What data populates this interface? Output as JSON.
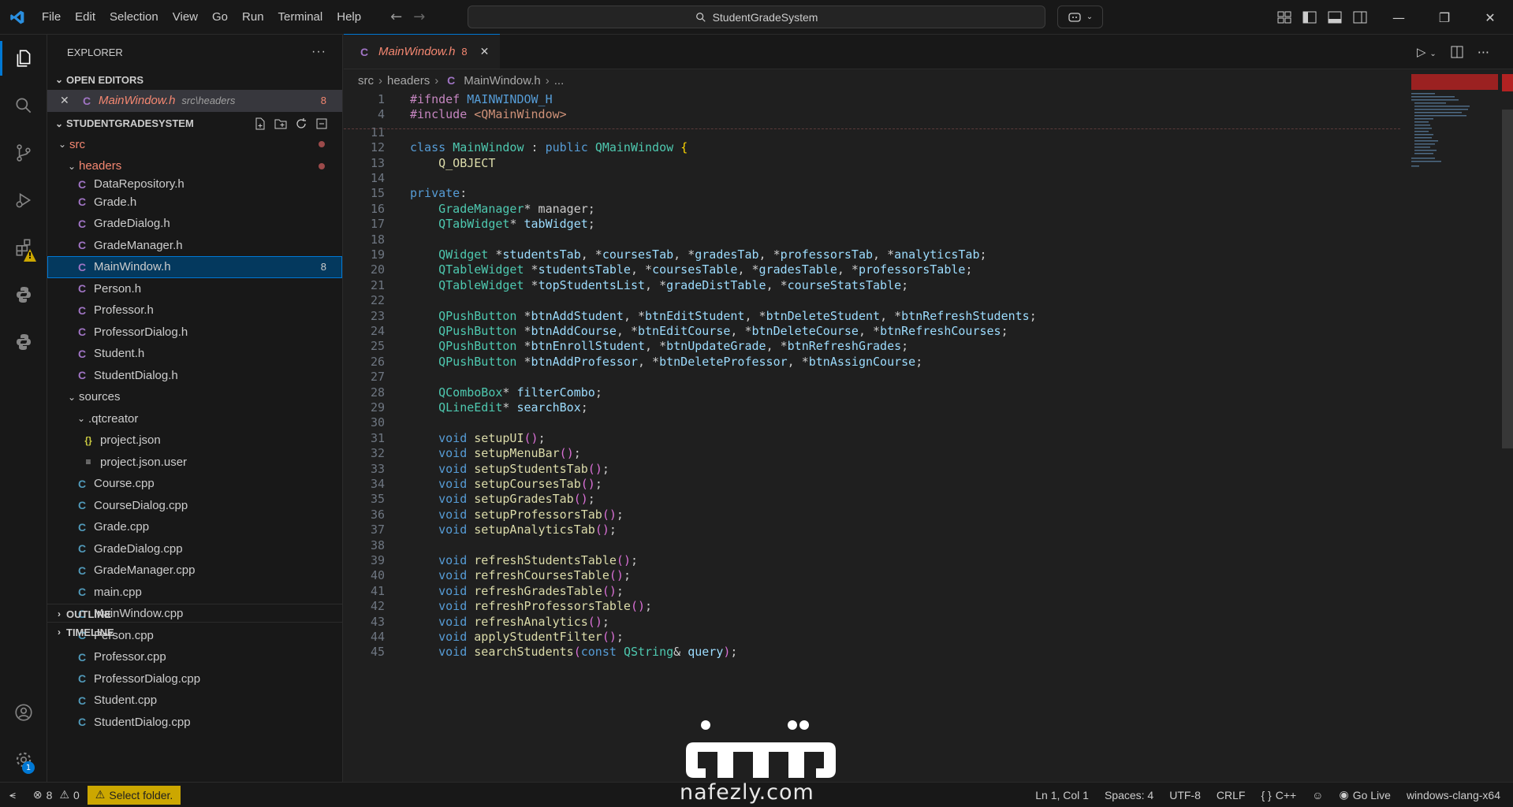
{
  "menu": [
    "File",
    "Edit",
    "Selection",
    "View",
    "Go",
    "Run",
    "Terminal",
    "Help"
  ],
  "search": {
    "text": "StudentGradeSystem"
  },
  "sidebar": {
    "title": "EXPLORER",
    "open_editors_label": "OPEN EDITORS",
    "open_editor": {
      "name": "MainWindow.h",
      "path": "src\\headers",
      "count": "8"
    },
    "project_label": "STUDENTGRADESYSTEM",
    "tree": [
      {
        "name": "src",
        "kind": "folder",
        "indent": 0,
        "dot": true
      },
      {
        "name": "headers",
        "kind": "folder",
        "indent": 1,
        "dot": true
      },
      {
        "name": "DataRepository.h",
        "kind": "h",
        "indent": 2
      },
      {
        "name": "Grade.h",
        "kind": "h",
        "indent": 2
      },
      {
        "name": "GradeDialog.h",
        "kind": "h",
        "indent": 2
      },
      {
        "name": "GradeManager.h",
        "kind": "h",
        "indent": 2
      },
      {
        "name": "MainWindow.h",
        "kind": "h",
        "indent": 2,
        "selected": true,
        "count": "8"
      },
      {
        "name": "Person.h",
        "kind": "h",
        "indent": 2
      },
      {
        "name": "Professor.h",
        "kind": "h",
        "indent": 2
      },
      {
        "name": "ProfessorDialog.h",
        "kind": "h",
        "indent": 2
      },
      {
        "name": "Student.h",
        "kind": "h",
        "indent": 2
      },
      {
        "name": "StudentDialog.h",
        "kind": "h",
        "indent": 2
      },
      {
        "name": "sources",
        "kind": "folder",
        "indent": 1
      },
      {
        "name": ".qtcreator",
        "kind": "folder",
        "indent": 2
      },
      {
        "name": "project.json",
        "kind": "json",
        "indent": 3
      },
      {
        "name": "project.json.user",
        "kind": "txt",
        "indent": 3
      },
      {
        "name": "Course.cpp",
        "kind": "cpp",
        "indent": 2
      },
      {
        "name": "CourseDialog.cpp",
        "kind": "cpp",
        "indent": 2
      },
      {
        "name": "Grade.cpp",
        "kind": "cpp",
        "indent": 2
      },
      {
        "name": "GradeDialog.cpp",
        "kind": "cpp",
        "indent": 2
      },
      {
        "name": "GradeManager.cpp",
        "kind": "cpp",
        "indent": 2
      },
      {
        "name": "main.cpp",
        "kind": "cpp",
        "indent": 2
      },
      {
        "name": "MainWindow.cpp",
        "kind": "cpp",
        "indent": 2
      },
      {
        "name": "Person.cpp",
        "kind": "cpp",
        "indent": 2
      },
      {
        "name": "Professor.cpp",
        "kind": "cpp",
        "indent": 2
      },
      {
        "name": "ProfessorDialog.cpp",
        "kind": "cpp",
        "indent": 2
      },
      {
        "name": "Student.cpp",
        "kind": "cpp",
        "indent": 2
      },
      {
        "name": "StudentDialog.cpp",
        "kind": "cpp",
        "indent": 2
      }
    ],
    "outline_label": "OUTLINE",
    "timeline_label": "TIMELINE"
  },
  "tab": {
    "name": "MainWindow.h",
    "count": "8"
  },
  "breadcrumb": [
    "src",
    "headers",
    "MainWindow.h",
    "..."
  ],
  "code": [
    {
      "n": "1",
      "t": "#ifndef MAINWINDOW_H"
    },
    {
      "n": "4",
      "t": "#include <QMainWindow>"
    },
    {
      "n": "11",
      "t": ""
    },
    {
      "n": "12",
      "t": "class MainWindow : public QMainWindow {"
    },
    {
      "n": "13",
      "t": "    Q_OBJECT"
    },
    {
      "n": "14",
      "t": ""
    },
    {
      "n": "15",
      "t": "private:"
    },
    {
      "n": "16",
      "t": "    GradeManager* manager;"
    },
    {
      "n": "17",
      "t": "    QTabWidget* tabWidget;"
    },
    {
      "n": "18",
      "t": ""
    },
    {
      "n": "19",
      "t": "    QWidget *studentsTab, *coursesTab, *gradesTab, *professorsTab, *analyticsTab;"
    },
    {
      "n": "20",
      "t": "    QTableWidget *studentsTable, *coursesTable, *gradesTable, *professorsTable;"
    },
    {
      "n": "21",
      "t": "    QTableWidget *topStudentsList, *gradeDistTable, *courseStatsTable;"
    },
    {
      "n": "22",
      "t": ""
    },
    {
      "n": "23",
      "t": "    QPushButton *btnAddStudent, *btnEditStudent, *btnDeleteStudent, *btnRefreshStudents;"
    },
    {
      "n": "24",
      "t": "    QPushButton *btnAddCourse, *btnEditCourse, *btnDeleteCourse, *btnRefreshCourses;"
    },
    {
      "n": "25",
      "t": "    QPushButton *btnEnrollStudent, *btnUpdateGrade, *btnRefreshGrades;"
    },
    {
      "n": "26",
      "t": "    QPushButton *btnAddProfessor, *btnDeleteProfessor, *btnAssignCourse;"
    },
    {
      "n": "27",
      "t": ""
    },
    {
      "n": "28",
      "t": "    QComboBox* filterCombo;"
    },
    {
      "n": "29",
      "t": "    QLineEdit* searchBox;"
    },
    {
      "n": "30",
      "t": ""
    },
    {
      "n": "31",
      "t": "    void setupUI();"
    },
    {
      "n": "32",
      "t": "    void setupMenuBar();"
    },
    {
      "n": "33",
      "t": "    void setupStudentsTab();"
    },
    {
      "n": "34",
      "t": "    void setupCoursesTab();"
    },
    {
      "n": "35",
      "t": "    void setupGradesTab();"
    },
    {
      "n": "36",
      "t": "    void setupProfessorsTab();"
    },
    {
      "n": "37",
      "t": "    void setupAnalyticsTab();"
    },
    {
      "n": "38",
      "t": ""
    },
    {
      "n": "39",
      "t": "    void refreshStudentsTable();"
    },
    {
      "n": "40",
      "t": "    void refreshCoursesTable();"
    },
    {
      "n": "41",
      "t": "    void refreshGradesTable();"
    },
    {
      "n": "42",
      "t": "    void refreshProfessorsTable();"
    },
    {
      "n": "43",
      "t": "    void refreshAnalytics();"
    },
    {
      "n": "44",
      "t": "    void applyStudentFilter();"
    },
    {
      "n": "45",
      "t": "    void searchStudents(const QString& query);"
    }
  ],
  "status": {
    "errors": "8",
    "warnings": "0",
    "select_folder": "Select folder.",
    "position": "Ln 1, Col 1",
    "spaces": "Spaces: 4",
    "encoding": "UTF-8",
    "eol": "CRLF",
    "language": "C++",
    "go_live": "Go Live",
    "config": "windows-clang-x64"
  },
  "watermark": {
    "text": "nafezly.com"
  },
  "colors": {
    "accent": "#0078d4",
    "warning": "#cca700",
    "error_text": "#f48771"
  }
}
